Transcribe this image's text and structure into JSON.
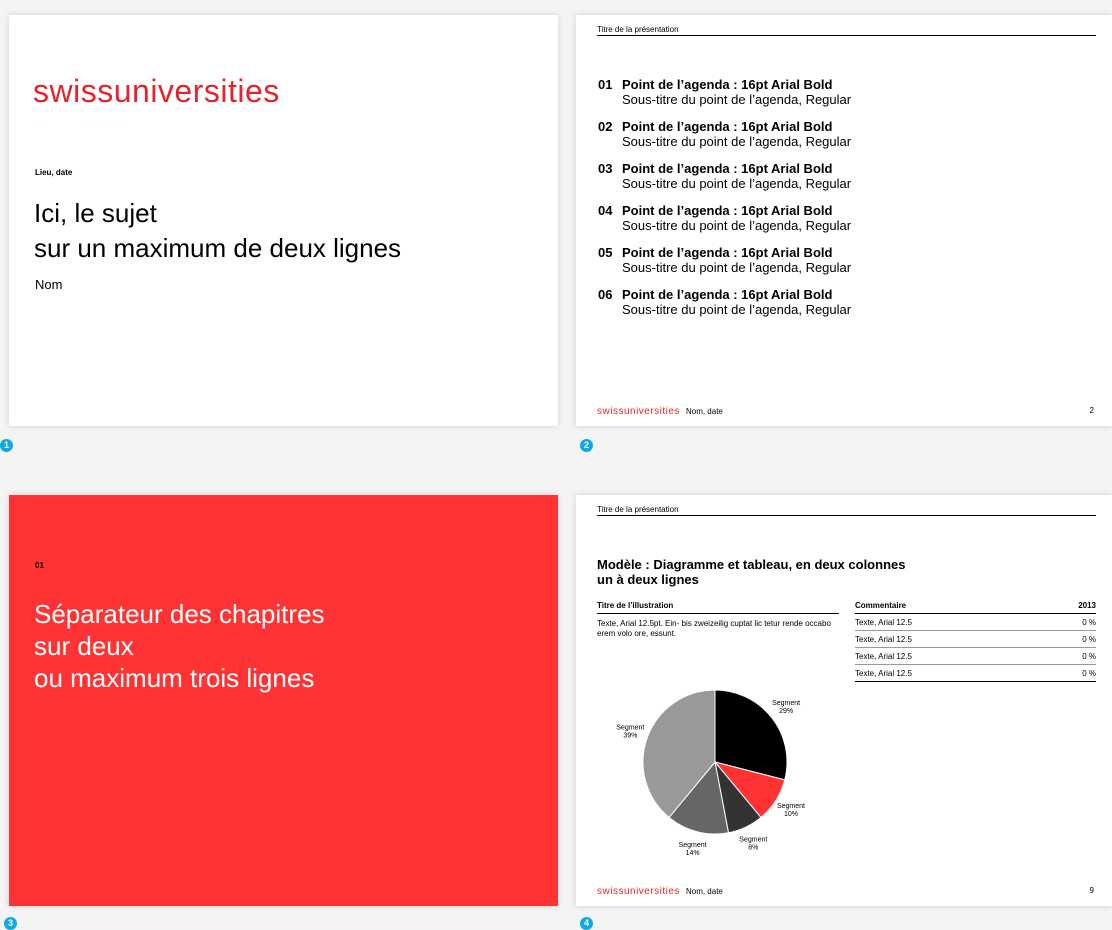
{
  "brand": {
    "logo": "swissuniversities",
    "accent": "#e4232b",
    "badge_color": "#11a9e0",
    "chapter_color": "#ff3333"
  },
  "slide1": {
    "badge": "1",
    "place_date": "Lieu, date",
    "title_line1": "Ici, le sujet",
    "title_line2": "sur un maximum de deux lignes",
    "name": "Nom"
  },
  "slide2": {
    "badge": "2",
    "header": "Titre de la présentation",
    "agenda": [
      {
        "num": "01",
        "title": "Point de l’agenda : 16pt Arial Bold",
        "subtitle": "Sous-titre du point de l’agenda, Regular"
      },
      {
        "num": "02",
        "title": "Point de l’agenda : 16pt Arial Bold",
        "subtitle": "Sous-titre du point de l’agenda, Regular"
      },
      {
        "num": "03",
        "title": "Point de l’agenda : 16pt Arial Bold",
        "subtitle": "Sous-titre du point de l’agenda, Regular"
      },
      {
        "num": "04",
        "title": "Point de l’agenda : 16pt Arial Bold",
        "subtitle": "Sous-titre du point de l’agenda, Regular"
      },
      {
        "num": "05",
        "title": "Point de l’agenda : 16pt Arial Bold",
        "subtitle": "Sous-titre du point de l’agenda, Regular"
      },
      {
        "num": "06",
        "title": "Point de l’agenda : 16pt Arial Bold",
        "subtitle": "Sous-titre du point de l’agenda, Regular"
      }
    ],
    "footer_text": "Nom, date",
    "page": "2"
  },
  "slide3": {
    "badge": "3",
    "chapter_num": "01",
    "title": "Séparateur des chapitres\nsur deux\nou maximum trois lignes"
  },
  "slide4": {
    "badge": "4",
    "header": "Titre de la présentation",
    "title": "Modèle : Diagramme et tableau, en deux colonnes\nun à deux lignes",
    "illustration_title": "Titre de l’illustration",
    "illustration_text": "Texte, Arial 12.5pt. Ein- bis zweizeilig cuptat lic tetur rende occabo erem volo ore, essunt.",
    "table": {
      "headers": [
        "Commentaire",
        "2013"
      ],
      "rows": [
        [
          "Texte, Arial 12.5",
          "0 %"
        ],
        [
          "Texte, Arial 12.5",
          "0 %"
        ],
        [
          "Texte, Arial 12.5",
          "0 %"
        ],
        [
          "Texte, Arial 12.5",
          "0 %"
        ]
      ]
    },
    "footer_text": "Nom, date",
    "page": "9"
  },
  "chart_data": {
    "type": "pie",
    "categories": [
      "Segment",
      "Segment",
      "Segment",
      "Segment",
      "Segment"
    ],
    "values": [
      29,
      10,
      8,
      14,
      39
    ],
    "labels": [
      "Segment 29%",
      "Segment 10%",
      "Segment 8%",
      "Segment 14%",
      "Segment 39%"
    ],
    "colors": [
      "#000000",
      "#ff3333",
      "#333333",
      "#666666",
      "#999999"
    ],
    "title": "",
    "legend": "none"
  }
}
